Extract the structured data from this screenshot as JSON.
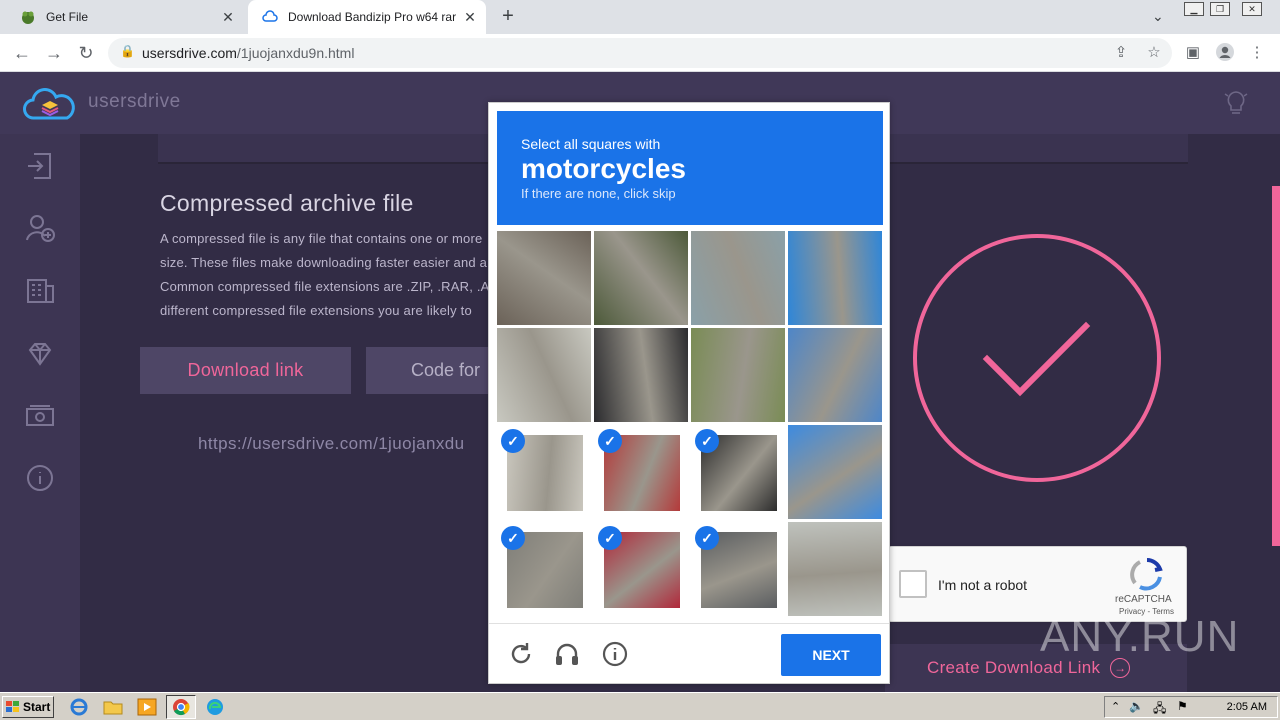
{
  "browser": {
    "tabs": [
      {
        "title": "Get File",
        "active": false
      },
      {
        "title": "Download Bandizip Pro w64 rar",
        "active": true
      }
    ],
    "address": {
      "host": "usersdrive.com",
      "path": "/1juojanxdu9n.html"
    }
  },
  "site": {
    "brand": "usersdrive",
    "content_title": "Compressed archive file",
    "paragraph_lines": [
      "A compressed file is any file that contains one or more",
      "size. These files make downloading faster easier and al",
      "Common compressed file extensions are .ZIP, .RAR, .AR",
      "different compressed file extensions you are likely to"
    ],
    "download_link_button": "Download link",
    "code_button": "Code for",
    "link_url": "https://usersdrive.com/1juojanxdu",
    "create_link": "Create Download Link"
  },
  "recaptcha": {
    "anchor_label": "I'm not a robot",
    "brand": "reCAPTCHA",
    "terms": "Privacy - Terms",
    "challenge": {
      "instruction": "Select all squares with",
      "target": "motorcycles",
      "hint": "If there are none, click skip",
      "grid": [
        [
          false,
          false,
          false,
          false
        ],
        [
          false,
          false,
          false,
          false
        ],
        [
          true,
          true,
          true,
          false
        ],
        [
          true,
          true,
          true,
          false
        ]
      ],
      "next_label": "NEXT"
    }
  },
  "watermark": "ANY.RUN",
  "taskbar": {
    "start_label": "Start",
    "clock": "2:05 AM"
  },
  "colors": {
    "accent_pink": "#f0669a",
    "recaptcha_blue": "#1a73e8",
    "page_bg": "#3a3350"
  }
}
